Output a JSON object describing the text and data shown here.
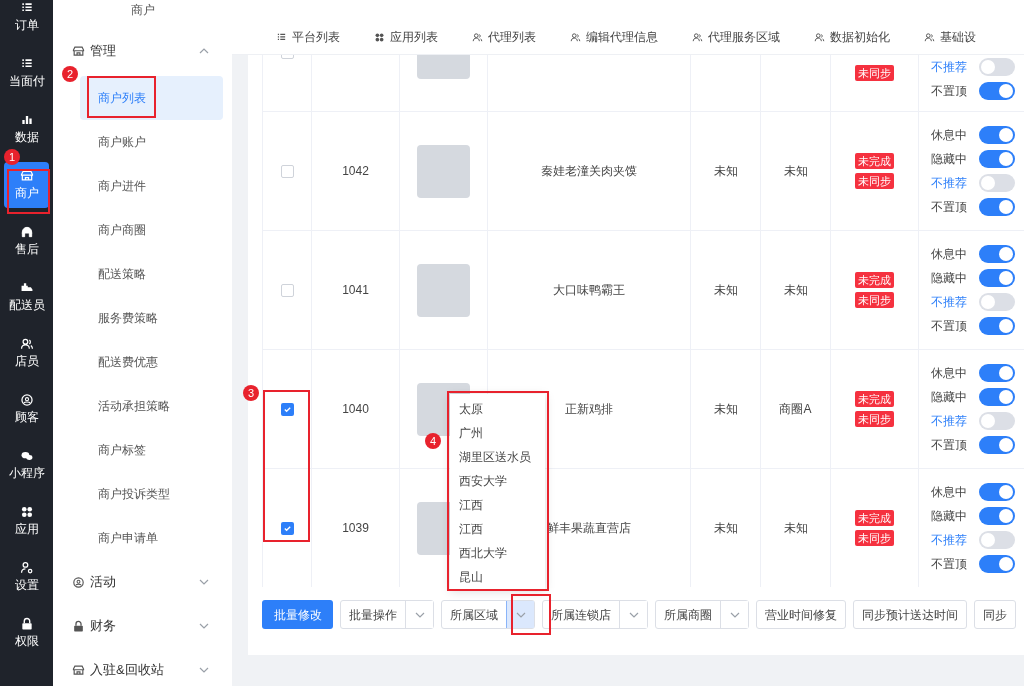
{
  "nav_rail": [
    {
      "label": "订单",
      "selected": false
    },
    {
      "label": "当面付",
      "selected": false
    },
    {
      "label": "数据",
      "selected": false
    },
    {
      "label": "商户",
      "selected": true
    },
    {
      "label": "售后",
      "selected": false
    },
    {
      "label": "配送员",
      "selected": false
    },
    {
      "label": "店员",
      "selected": false
    },
    {
      "label": "顾客",
      "selected": false
    },
    {
      "label": "小程序",
      "selected": false
    },
    {
      "label": "应用",
      "selected": false
    },
    {
      "label": "设置",
      "selected": false
    },
    {
      "label": "权限",
      "selected": false
    }
  ],
  "submenu": {
    "title": "商户",
    "groups": [
      {
        "label": "管理",
        "expanded": true,
        "items": [
          {
            "label": "商户列表",
            "selected": true
          },
          {
            "label": "商户账户",
            "selected": false
          },
          {
            "label": "商户进件",
            "selected": false
          },
          {
            "label": "商户商圈",
            "selected": false
          },
          {
            "label": "配送策略",
            "selected": false
          },
          {
            "label": "服务费策略",
            "selected": false
          },
          {
            "label": "配送费优惠",
            "selected": false
          },
          {
            "label": "活动承担策略",
            "selected": false
          },
          {
            "label": "商户标签",
            "selected": false
          },
          {
            "label": "商户投诉类型",
            "selected": false
          },
          {
            "label": "商户申请单",
            "selected": false
          }
        ]
      },
      {
        "label": "活动",
        "expanded": false
      },
      {
        "label": "财务",
        "expanded": false
      },
      {
        "label": "入驻&回收站",
        "expanded": false
      }
    ]
  },
  "tabs": [
    "平台列表",
    "应用列表",
    "代理列表",
    "编辑代理信息",
    "代理服务区域",
    "数据初始化",
    "基础设"
  ],
  "table": {
    "rows": [
      {
        "cut_off": true,
        "checked": false,
        "id": "",
        "name": "",
        "column_5": "",
        "column_6": "",
        "tags": [
          "未同步"
        ],
        "toggles": [
          {
            "label": "不推荐",
            "on": false
          },
          {
            "label": "不置顶",
            "on": true
          }
        ]
      },
      {
        "cut_off": false,
        "checked": false,
        "id": "1042",
        "name": "秦娃老潼关肉夹馍",
        "column_5": "未知",
        "column_6": "未知",
        "tags": [
          "未完成",
          "未同步"
        ],
        "toggles": [
          {
            "label": "休息中",
            "on": true
          },
          {
            "label": "隐藏中",
            "on": true
          },
          {
            "label": "不推荐",
            "on": false
          },
          {
            "label": "不置顶",
            "on": true
          }
        ]
      },
      {
        "cut_off": false,
        "checked": false,
        "id": "1041",
        "name": "大口味鸭霸王",
        "column_5": "未知",
        "column_6": "未知",
        "tags": [
          "未完成",
          "未同步"
        ],
        "toggles": [
          {
            "label": "休息中",
            "on": true
          },
          {
            "label": "隐藏中",
            "on": true
          },
          {
            "label": "不推荐",
            "on": false
          },
          {
            "label": "不置顶",
            "on": true
          }
        ]
      },
      {
        "cut_off": false,
        "checked": true,
        "id": "1040",
        "name": "正新鸡排",
        "column_5": "未知",
        "column_6": "商圈A",
        "tags": [
          "未完成",
          "未同步"
        ],
        "toggles": [
          {
            "label": "休息中",
            "on": true
          },
          {
            "label": "隐藏中",
            "on": true
          },
          {
            "label": "不推荐",
            "on": false
          },
          {
            "label": "不置顶",
            "on": true
          }
        ]
      },
      {
        "cut_off": false,
        "checked": true,
        "id": "1039",
        "name": "鲜丰果蔬直营店",
        "column_5": "未知",
        "column_6": "未知",
        "tags": [
          "未完成",
          "未同步"
        ],
        "toggles": [
          {
            "label": "休息中",
            "on": true
          },
          {
            "label": "隐藏中",
            "on": true
          },
          {
            "label": "不推荐",
            "on": false
          },
          {
            "label": "不置顶",
            "on": true
          }
        ]
      }
    ]
  },
  "region_dropdown": [
    "太原",
    "广州",
    "湖里区送水员",
    "西安大学",
    "江西",
    "江西",
    "西北大学",
    "昆山"
  ],
  "toolbar": [
    {
      "label": "批量修改",
      "kind": "primary"
    },
    {
      "label": "批量操作",
      "kind": "split",
      "open": false
    },
    {
      "label": "所属区域",
      "kind": "split",
      "open": true
    },
    {
      "label": "所属连锁店",
      "kind": "split",
      "open": false
    },
    {
      "label": "所属商圈",
      "kind": "split",
      "open": false
    },
    {
      "label": "营业时间修复",
      "kind": "plain"
    },
    {
      "label": "同步预计送达时间",
      "kind": "plain"
    },
    {
      "label": "同步",
      "kind": "plain"
    }
  ],
  "annotations": [
    "1",
    "2",
    "3",
    "4"
  ]
}
